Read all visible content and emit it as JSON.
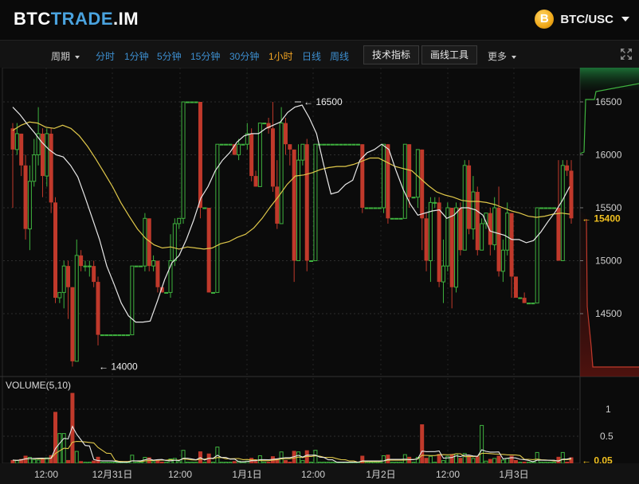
{
  "header": {
    "brand_part1": "BTC",
    "brand_part2": "TRADE",
    "brand_part3": ".IM",
    "pair_label": "BTC/USC",
    "coin_symbol": "B"
  },
  "toolbar": {
    "period_label": "周期",
    "timeframes": [
      "分时",
      "1分钟",
      "5分钟",
      "15分钟",
      "30分钟",
      "1小时",
      "日线",
      "周线"
    ],
    "active_timeframe": "1小时",
    "indicators_btn": "技术指标",
    "drawing_btn": "画线工具",
    "more_label": "更多"
  },
  "colors": {
    "up": "#3fb33f",
    "down": "#c0392b",
    "ma_white": "#e8e8e8",
    "ma_yellow": "#e0c84a",
    "accent_blue": "#3d8fd0",
    "active": "#f5a623"
  },
  "chart_data": {
    "type": "candlestick",
    "price_axis": {
      "ticks": [
        14500,
        15000,
        15500,
        16000,
        16500
      ],
      "min": 13900,
      "max": 16600
    },
    "current_price_label": "15400",
    "max_label": "16500",
    "min_label": "14000",
    "volume_title": "VOLUME(5,10)",
    "volume_axis": {
      "ticks": [
        "0.5",
        "1"
      ],
      "min": 0,
      "max": 1.3
    },
    "current_volume_label": "0.05",
    "x_labels": [
      "12:00",
      "12月31日",
      "12:00",
      "1月1日",
      "12:00",
      "1月2日",
      "12:00",
      "1月3日"
    ],
    "candles": [
      [
        16250,
        16050,
        16300,
        15500
      ],
      [
        16050,
        16200,
        16300,
        16000
      ],
      [
        16200,
        15900,
        16200,
        15800
      ],
      [
        15900,
        15300,
        16000,
        15200
      ],
      [
        15300,
        15750,
        15900,
        15100
      ],
      [
        15750,
        16000,
        16150,
        15700
      ],
      [
        16000,
        16200,
        16450,
        15900
      ],
      [
        16200,
        15800,
        16250,
        15600
      ],
      [
        15800,
        16200,
        16250,
        15700
      ],
      [
        16200,
        15550,
        16250,
        15450
      ],
      [
        15550,
        14650,
        15600,
        14600
      ],
      [
        14650,
        14700,
        14700,
        14600
      ],
      [
        14700,
        14950,
        15000,
        14550
      ],
      [
        14950,
        14750,
        15000,
        14450
      ],
      [
        14750,
        14050,
        14750,
        14000
      ],
      [
        14050,
        15050,
        15200,
        14050
      ],
      [
        15050,
        14950,
        15100,
        14900
      ],
      [
        14950,
        14950,
        15000,
        14900
      ],
      [
        14950,
        14950,
        15000,
        14850
      ],
      [
        14950,
        14800,
        15000,
        14750
      ],
      [
        14800,
        14300,
        14850,
        14200
      ],
      [
        14300,
        14300,
        14300,
        14300
      ],
      [
        14300,
        14300,
        14300,
        14300
      ],
      [
        14300,
        14300,
        14300,
        14300
      ],
      [
        14300,
        14300,
        14300,
        14300
      ],
      [
        14300,
        14300,
        14300,
        14300
      ],
      [
        14300,
        14300,
        14300,
        14300
      ],
      [
        14300,
        14300,
        14300,
        14300
      ],
      [
        14300,
        14950,
        14950,
        14300
      ],
      [
        14950,
        14950,
        14950,
        14950
      ],
      [
        14950,
        14950,
        14950,
        14950
      ],
      [
        14950,
        15400,
        15450,
        14900
      ],
      [
        15400,
        14950,
        15400,
        14900
      ],
      [
        14950,
        15000,
        15050,
        14900
      ],
      [
        15000,
        14750,
        15000,
        14700
      ],
      [
        14750,
        14700,
        14750,
        14700
      ],
      [
        14700,
        14700,
        14700,
        14700
      ],
      [
        14700,
        15000,
        15250,
        14650
      ],
      [
        15000,
        15350,
        15400,
        14950
      ],
      [
        15350,
        15400,
        15400,
        15300
      ],
      [
        15400,
        16500,
        16500,
        15350
      ],
      [
        16500,
        16500,
        16500,
        16500
      ],
      [
        16500,
        16500,
        16500,
        16500
      ],
      [
        16500,
        16500,
        16500,
        16500
      ],
      [
        16500,
        15500,
        16500,
        15400
      ],
      [
        15500,
        15500,
        15500,
        15500
      ],
      [
        15500,
        14700,
        15500,
        14700
      ],
      [
        14700,
        14700,
        14700,
        14700
      ],
      [
        14700,
        16100,
        16100,
        14700
      ],
      [
        16100,
        16100,
        16100,
        16100
      ],
      [
        16100,
        16100,
        16100,
        16100
      ],
      [
        16100,
        16100,
        16100,
        16100
      ],
      [
        16100,
        16000,
        16100,
        16000
      ],
      [
        16000,
        16100,
        16150,
        15950
      ],
      [
        16100,
        16100,
        16100,
        16100
      ],
      [
        16100,
        16200,
        16300,
        16050
      ],
      [
        16200,
        15800,
        16250,
        15750
      ],
      [
        15800,
        15700,
        15850,
        15700
      ],
      [
        15700,
        16300,
        16300,
        15700
      ],
      [
        16300,
        16300,
        16300,
        16300
      ],
      [
        16300,
        16250,
        16350,
        16200
      ],
      [
        16250,
        15700,
        16500,
        15650
      ],
      [
        15700,
        15350,
        15950,
        15300
      ],
      [
        15350,
        16300,
        16450,
        15350
      ],
      [
        16300,
        16100,
        16350,
        16000
      ],
      [
        16100,
        16050,
        16100,
        15900
      ],
      [
        16050,
        15000,
        16050,
        14800
      ],
      [
        15000,
        15950,
        16100,
        15000
      ],
      [
        15950,
        16100,
        16100,
        15900
      ],
      [
        16100,
        15000,
        16150,
        14900
      ],
      [
        15000,
        15000,
        15000,
        15000
      ],
      [
        15000,
        16100,
        16100,
        15000
      ],
      [
        16100,
        16100,
        16100,
        16100
      ],
      [
        16100,
        16100,
        16100,
        16100
      ],
      [
        16100,
        16100,
        16100,
        16100
      ],
      [
        16100,
        16100,
        16100,
        16100
      ],
      [
        16100,
        16100,
        16100,
        16100
      ],
      [
        16100,
        16100,
        16100,
        16100
      ],
      [
        16100,
        16100,
        16100,
        16100
      ],
      [
        16100,
        16100,
        16100,
        16100
      ],
      [
        16100,
        16100,
        16100,
        16100
      ],
      [
        16100,
        16100,
        16100,
        16100
      ],
      [
        16100,
        15500,
        16100,
        15450
      ],
      [
        15500,
        15500,
        15500,
        15500
      ],
      [
        15500,
        15500,
        15500,
        15500
      ],
      [
        15500,
        15500,
        15500,
        15500
      ],
      [
        15500,
        15500,
        15500,
        15500
      ],
      [
        15500,
        16100,
        16100,
        15450
      ],
      [
        16100,
        15400,
        16100,
        15350
      ],
      [
        15400,
        15400,
        15400,
        15400
      ],
      [
        15400,
        15400,
        15400,
        15400
      ],
      [
        15400,
        15400,
        15400,
        15400
      ],
      [
        15400,
        16100,
        16100,
        15400
      ],
      [
        16100,
        15600,
        16100,
        15500
      ],
      [
        15600,
        15600,
        15600,
        15600
      ],
      [
        15600,
        16050,
        16050,
        15500
      ],
      [
        16050,
        15400,
        16050,
        15100
      ],
      [
        15400,
        15000,
        15450,
        14900
      ],
      [
        15000,
        15550,
        15600,
        14800
      ],
      [
        15550,
        15550,
        15600,
        15500
      ],
      [
        15550,
        14800,
        15600,
        14750
      ],
      [
        14800,
        14950,
        15200,
        14600
      ],
      [
        14950,
        15500,
        15550,
        14900
      ],
      [
        15500,
        14750,
        15500,
        14550
      ],
      [
        14750,
        15500,
        15550,
        14700
      ],
      [
        15500,
        15100,
        15550,
        15050
      ],
      [
        15100,
        15900,
        15950,
        15100
      ],
      [
        15900,
        15300,
        15950,
        15250
      ],
      [
        15300,
        15650,
        15800,
        15200
      ],
      [
        15650,
        15100,
        15700,
        15050
      ],
      [
        15100,
        15350,
        15400,
        15100
      ],
      [
        15350,
        15450,
        15450,
        15300
      ],
      [
        15450,
        15150,
        15500,
        15050
      ],
      [
        15150,
        15500,
        15600,
        15100
      ],
      [
        15500,
        14900,
        15700,
        14850
      ],
      [
        14900,
        15100,
        15200,
        14800
      ],
      [
        15100,
        15450,
        15550,
        15050
      ],
      [
        15450,
        14850,
        15450,
        14650
      ],
      [
        14850,
        14650,
        14850,
        14650
      ],
      [
        14650,
        14650,
        14650,
        14650
      ],
      [
        14650,
        14600,
        14700,
        14600
      ],
      [
        14600,
        14600,
        14600,
        14600
      ],
      [
        14600,
        14600,
        14600,
        14600
      ],
      [
        14600,
        15500,
        15500,
        14600
      ],
      [
        15500,
        15500,
        15500,
        15500
      ],
      [
        15500,
        15500,
        15500,
        15500
      ],
      [
        15500,
        15500,
        15500,
        15500
      ],
      [
        15500,
        15500,
        15500,
        15500
      ],
      [
        15500,
        15000,
        15950,
        15000
      ],
      [
        15000,
        15900,
        15950,
        15000
      ],
      [
        15900,
        15850,
        15950,
        15800
      ],
      [
        15850,
        15400,
        15950,
        15350
      ]
    ],
    "ma_white": [
      16450,
      16380,
      16290,
      16210,
      16120,
      16050,
      16000,
      15980,
      15900,
      15790,
      15600,
      15400,
      15200,
      14950,
      14780,
      14600,
      14480,
      14420,
      14420,
      14430,
      14620,
      14820,
      14980,
      15050,
      15200,
      15380,
      15590,
      15700,
      15850,
      15950,
      16020,
      16120,
      16180,
      16200,
      16200,
      16250,
      16280,
      16310,
      16400,
      16450,
      16470,
      16350,
      16200,
      15900,
      15630,
      15650,
      15720,
      15760,
      15950,
      16020,
      16050,
      16100,
      16050,
      15850,
      15670,
      15530,
      15430,
      15450,
      15470,
      15480,
      15400,
      15430,
      15500,
      15500,
      15480,
      15430,
      15280,
      15260,
      15240,
      15200,
      15200,
      15170,
      15190,
      15270,
      15370,
      15460,
      15570,
      15700
    ],
    "ma_yellow": [
      16230,
      16280,
      16310,
      16300,
      16260,
      16250,
      16280,
      16250,
      16180,
      16080,
      15960,
      15830,
      15700,
      15550,
      15420,
      15300,
      15210,
      15150,
      15120,
      15130,
      15110,
      15130,
      15120,
      15110,
      15120,
      15160,
      15180,
      15220,
      15250,
      15310,
      15400,
      15510,
      15610,
      15720,
      15800,
      15810,
      15830,
      15860,
      15880,
      15890,
      15890,
      15910,
      15940,
      15970,
      15970,
      15930,
      15890,
      15870,
      15850,
      15780,
      15710,
      15650,
      15620,
      15600,
      15570,
      15560,
      15560,
      15550,
      15530,
      15500,
      15470,
      15450,
      15420,
      15410,
      15420,
      15440,
      15450,
      15440
    ]
  }
}
